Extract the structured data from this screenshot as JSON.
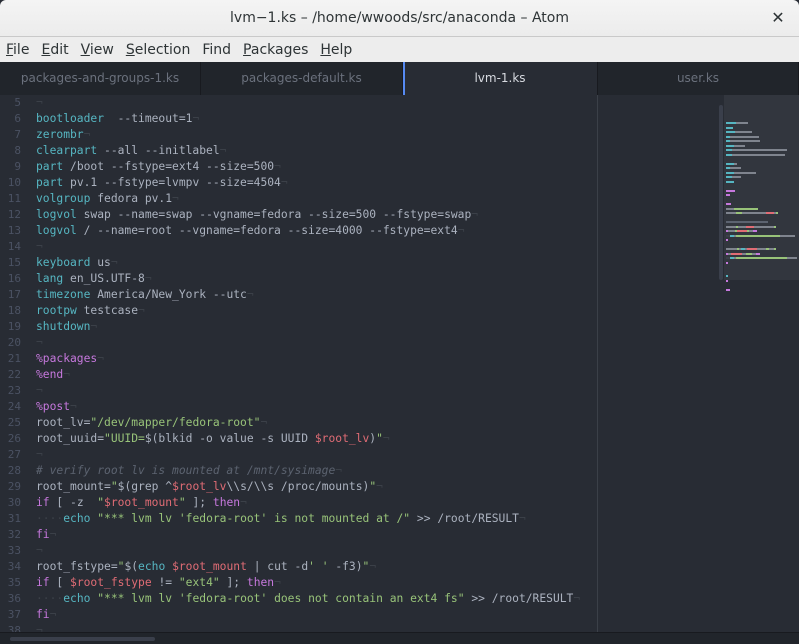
{
  "window": {
    "title": "lvm−1.ks – /home/wwoods/src/anaconda – Atom",
    "close_icon": "✕"
  },
  "menu": [
    {
      "label": "File",
      "mnemonic": "F",
      "rest": "ile"
    },
    {
      "label": "Edit",
      "mnemonic": "E",
      "rest": "dit"
    },
    {
      "label": "View",
      "mnemonic": "V",
      "rest": "iew"
    },
    {
      "label": "Selection",
      "mnemonic": "S",
      "rest": "election"
    },
    {
      "label": "Find",
      "mnemonic": "",
      "rest": "Find"
    },
    {
      "label": "Packages",
      "mnemonic": "P",
      "rest": "ackages"
    },
    {
      "label": "Help",
      "mnemonic": "H",
      "rest": "elp"
    }
  ],
  "tabs": [
    {
      "label": "packages-and-groups-1.ks",
      "active": false
    },
    {
      "label": "packages-default.ks",
      "active": false
    },
    {
      "label": "lvm-1.ks",
      "active": true
    },
    {
      "label": "user.ks",
      "active": false
    }
  ],
  "editor": {
    "first_line": 5,
    "eol_marker": "¬",
    "lines": [
      [],
      [
        [
          "kw",
          "bootloader"
        ],
        [
          "",
          "  --timeout=1"
        ]
      ],
      [
        [
          "kw",
          "zerombr"
        ]
      ],
      [
        [
          "kw",
          "clearpart"
        ],
        [
          "",
          " --all --initlabel"
        ]
      ],
      [
        [
          "kw",
          "part"
        ],
        [
          "",
          " /boot --fstype=ext4 --size=500"
        ]
      ],
      [
        [
          "kw",
          "part"
        ],
        [
          "",
          " pv.1 --fstype=lvmpv --size=4504"
        ]
      ],
      [
        [
          "kw",
          "volgroup"
        ],
        [
          "",
          " fedora pv.1"
        ]
      ],
      [
        [
          "kw",
          "logvol"
        ],
        [
          "",
          " swap --name=swap --vgname=fedora --size=500 --fstype=swap"
        ]
      ],
      [
        [
          "kw",
          "logvol"
        ],
        [
          "",
          " / --name=root --vgname=fedora --size=4000 --fstype=ext4"
        ]
      ],
      [],
      [
        [
          "kw",
          "keyboard"
        ],
        [
          "",
          " us"
        ]
      ],
      [
        [
          "kw",
          "lang"
        ],
        [
          "",
          " en_US.UTF-8"
        ]
      ],
      [
        [
          "kw",
          "timezone"
        ],
        [
          "",
          " America/New_York --utc"
        ]
      ],
      [
        [
          "kw",
          "rootpw"
        ],
        [
          "",
          " testcase"
        ]
      ],
      [
        [
          "kw",
          "shutdown"
        ]
      ],
      [],
      [
        [
          "pct",
          "%packages"
        ]
      ],
      [
        [
          "pct",
          "%end"
        ]
      ],
      [],
      [
        [
          "pct",
          "%post"
        ]
      ],
      [
        [
          "",
          "root_lv="
        ],
        [
          "str",
          "\"/dev/mapper/fedora-root\""
        ]
      ],
      [
        [
          "",
          "root_uuid="
        ],
        [
          "str",
          "\"UUID="
        ],
        [
          "",
          "$(blkid -o value -s UUID "
        ],
        [
          "var",
          "$root_lv"
        ],
        [
          "",
          ")"
        ],
        [
          "str",
          "\""
        ]
      ],
      [],
      [
        [
          "cmt",
          "# verify root lv is mounted at /mnt/sysimage"
        ]
      ],
      [
        [
          "",
          "root_mount="
        ],
        [
          "str",
          "\""
        ],
        [
          "",
          "$(grep ^"
        ],
        [
          "var",
          "$root_lv"
        ],
        [
          "",
          "\\\\s/\\\\s /proc/mounts)"
        ],
        [
          "str",
          "\""
        ]
      ],
      [
        [
          "ctl",
          "if"
        ],
        [
          "",
          " [ -z  "
        ],
        [
          "str",
          "\""
        ],
        [
          "var",
          "$root_mount"
        ],
        [
          "str",
          "\""
        ],
        [
          "",
          " ]; "
        ],
        [
          "ctl",
          "then"
        ]
      ],
      [
        [
          "ind",
          "····"
        ],
        [
          "kw",
          "echo"
        ],
        [
          "",
          " "
        ],
        [
          "str",
          "\"*** lvm lv 'fedora-root' is not mounted at /\""
        ],
        [
          "",
          " >> /root/RESULT"
        ]
      ],
      [
        [
          "ctl",
          "fi"
        ]
      ],
      [],
      [
        [
          "",
          "root_fstype="
        ],
        [
          "str",
          "\""
        ],
        [
          "",
          "$("
        ],
        [
          "kw",
          "echo"
        ],
        [
          "",
          " "
        ],
        [
          "var",
          "$root_mount"
        ],
        [
          "",
          " | cut -d"
        ],
        [
          "str",
          "' '"
        ],
        [
          "",
          " -f3)"
        ],
        [
          "str",
          "\""
        ]
      ],
      [
        [
          "ctl",
          "if"
        ],
        [
          "",
          " [ "
        ],
        [
          "var",
          "$root_fstype"
        ],
        [
          "",
          " != "
        ],
        [
          "str",
          "\"ext4\""
        ],
        [
          "",
          " ]; "
        ],
        [
          "ctl",
          "then"
        ]
      ],
      [
        [
          "ind",
          "····"
        ],
        [
          "kw",
          "echo"
        ],
        [
          "",
          " "
        ],
        [
          "str",
          "\"*** lvm lv 'fedora-root' does not contain an ext4 fs\""
        ],
        [
          "",
          " >> /root/RESULT"
        ]
      ],
      [
        [
          "ctl",
          "fi"
        ]
      ],
      []
    ]
  },
  "colors": {
    "keyword": "#56b6c2",
    "directive": "#c678dd",
    "string": "#98c379",
    "variable": "#e06c75",
    "comment": "#5c6370",
    "text": "#abb2bf",
    "accent": "#568af2",
    "background": "#282c34"
  }
}
